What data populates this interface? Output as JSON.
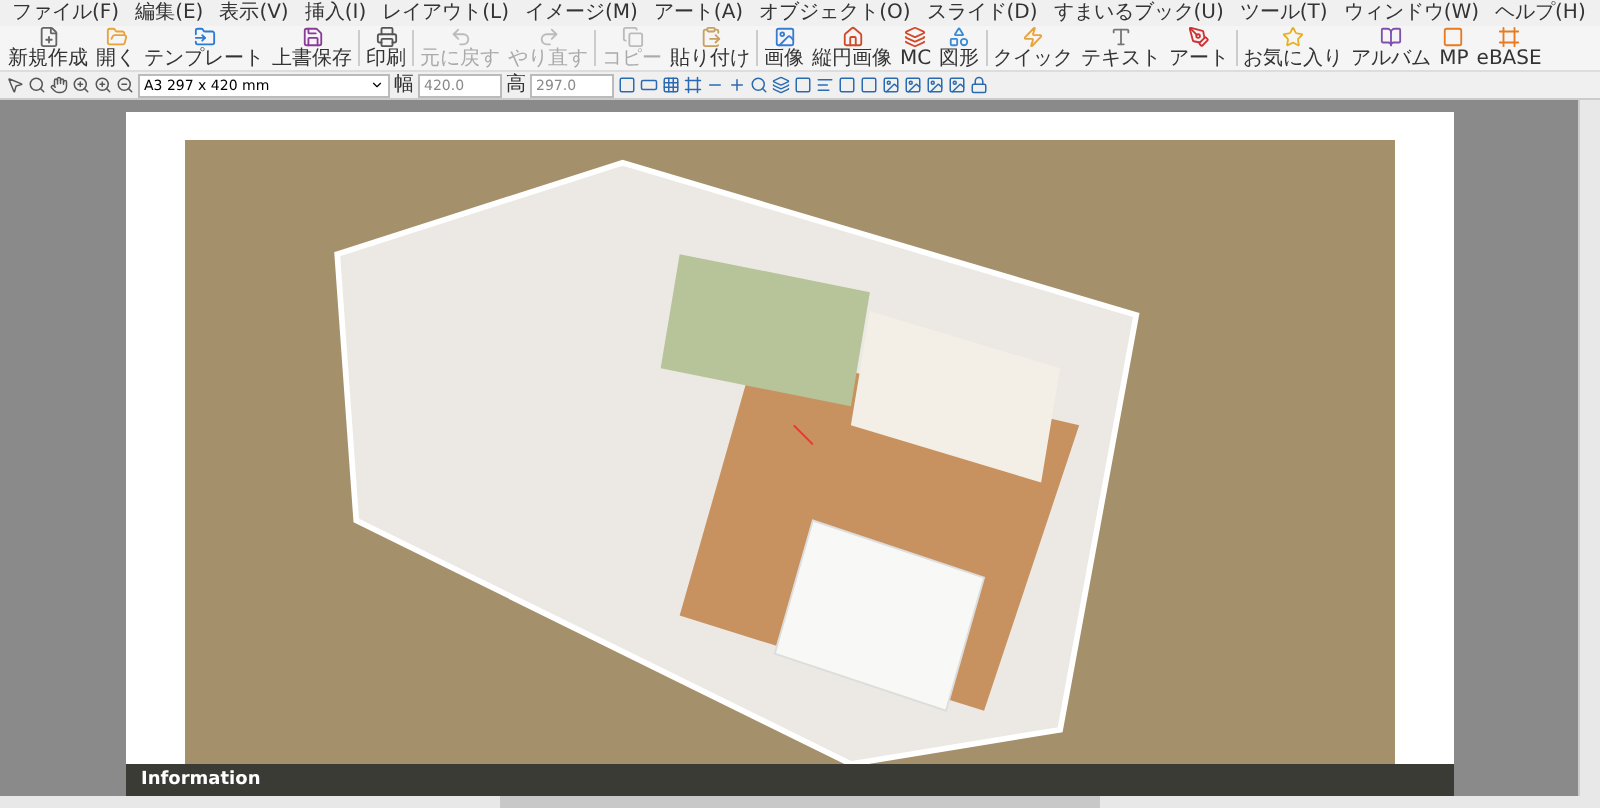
{
  "menu": [
    {
      "label": "ファイル(F)"
    },
    {
      "label": "編集(E)"
    },
    {
      "label": "表示(V)"
    },
    {
      "label": "挿入(I)"
    },
    {
      "label": "レイアウト(L)"
    },
    {
      "label": "イメージ(M)"
    },
    {
      "label": "アート(A)"
    },
    {
      "label": "オブジェクト(O)"
    },
    {
      "label": "スライド(D)"
    },
    {
      "label": "すまいるブック(U)"
    },
    {
      "label": "ツール(T)"
    },
    {
      "label": "ウィンドウ(W)"
    },
    {
      "label": "ヘルプ(H)"
    }
  ],
  "toolbar": [
    {
      "label": "新規作成",
      "disabled": false
    },
    {
      "label": "開く",
      "disabled": false
    },
    {
      "label": "テンプレート",
      "disabled": false
    },
    {
      "label": "上書保存",
      "disabled": false
    },
    {
      "label": "印刷",
      "disabled": false
    },
    {
      "label": "元に戻す",
      "disabled": true
    },
    {
      "label": "やり直す",
      "disabled": true
    },
    {
      "label": "コピー",
      "disabled": true
    },
    {
      "label": "貼り付け",
      "disabled": false
    },
    {
      "label": "画像",
      "disabled": false
    },
    {
      "label": "縦円画像",
      "disabled": false
    },
    {
      "label": "MC",
      "disabled": false
    },
    {
      "label": "図形",
      "disabled": false
    },
    {
      "label": "クイック",
      "disabled": false
    },
    {
      "label": "テキスト",
      "disabled": false
    },
    {
      "label": "アート",
      "disabled": false
    },
    {
      "label": "お気に入り",
      "disabled": false
    },
    {
      "label": "アルバム",
      "disabled": false
    },
    {
      "label": "MP",
      "disabled": false
    },
    {
      "label": "eBASE",
      "disabled": false
    }
  ],
  "format_bar": {
    "paper_size": "A3 297 x 420 mm",
    "width_label": "幅",
    "width_value": "420.0",
    "height_label": "高",
    "height_value": "297.0"
  },
  "page": {
    "footer_title": "Information"
  }
}
